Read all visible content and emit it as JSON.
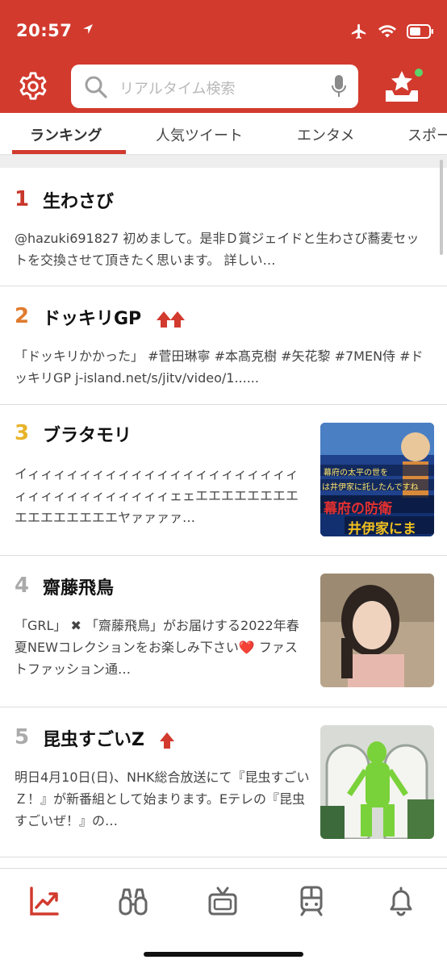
{
  "status_bar": {
    "time": "20:57"
  },
  "search": {
    "placeholder": "リアルタイム検索"
  },
  "tabs": [
    {
      "label": "ランキング"
    },
    {
      "label": "人気ツイート"
    },
    {
      "label": "エンタメ"
    },
    {
      "label": "スポー"
    }
  ],
  "colors": {
    "brand": "#d23a2e",
    "rank1": "#c8372c",
    "rank2": "#e07b2e",
    "rank3": "#e8b32a",
    "rank_other": "#aaaaaa",
    "trend_up": "#d23a2e"
  },
  "ranking": [
    {
      "rank": "1",
      "title": "生わさび",
      "desc": "@hazuki691827 初めまして。是非Ｄ賞ジェイドと生わさび蕎麦セットを交換させて頂きたく思います。 詳しい…",
      "trend": "none"
    },
    {
      "rank": "2",
      "title": "ドッキリGP",
      "desc": "「ドッキリかかった」 #菅田琳寧 #本髙克樹 #矢花黎 #7MEN侍 #ドッキリGP j-island.net/s/jitv/video/1......",
      "trend": "up2"
    },
    {
      "rank": "3",
      "title": "ブラタモリ",
      "desc": "イィィィィィィィィィィィィィィィィィィィィィィィィィィィィィィィィィェェエエエエエエエエエエエエエエエエヤァァァァ…",
      "trend": "none"
    },
    {
      "rank": "4",
      "title": "齋藤飛鳥",
      "desc": "「GRL」 ✖ 「齋藤飛鳥」がお届けする2022年春夏NEWコレクションをお楽しみ下さい❤️ ファストファッション通…",
      "trend": "none"
    },
    {
      "rank": "5",
      "title": "昆虫すごいZ",
      "desc": "明日4月10日(日)、NHK総合放送にて『昆虫すごいＺ！』が新番組として始まります。Eテレの『昆虫すごいぜ！』の…",
      "trend": "up1"
    }
  ],
  "thumbnails": {
    "item3": {
      "caption_1": "幕府の太平の世を",
      "caption_2": "は井伊家に託したんですね",
      "caption_3": "幕府の防衛",
      "caption_4": "井伊家にま"
    }
  },
  "bottom_nav": [
    {
      "icon": "trend-chart-icon"
    },
    {
      "icon": "binoculars-icon"
    },
    {
      "icon": "tv-icon"
    },
    {
      "icon": "train-icon"
    },
    {
      "icon": "bell-icon"
    }
  ]
}
